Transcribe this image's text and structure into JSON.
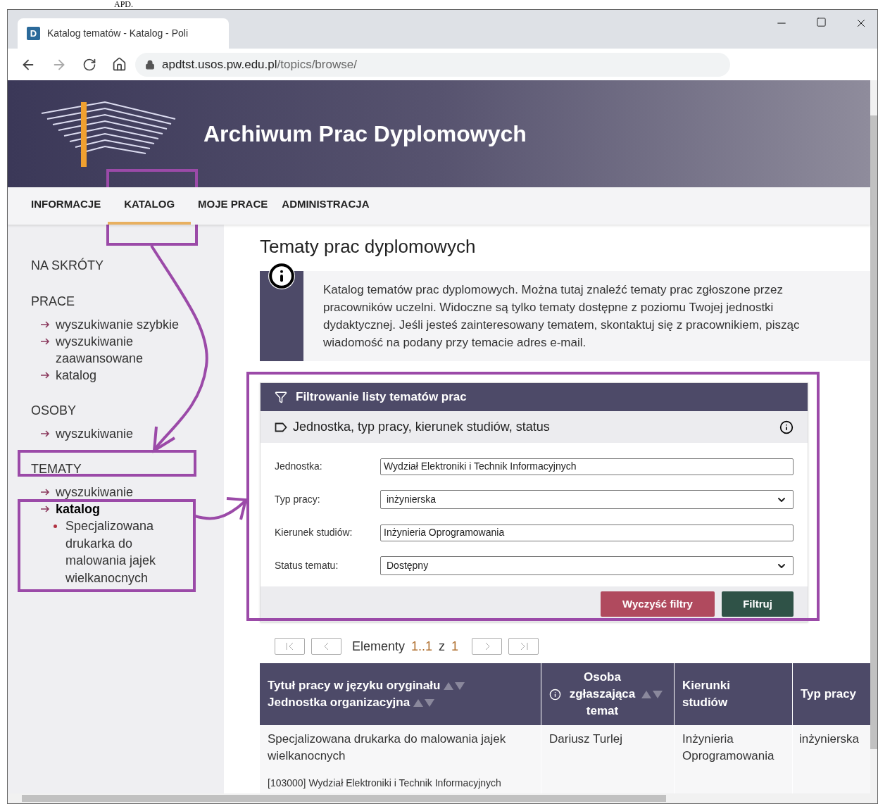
{
  "caption_fragment": "APD.",
  "browser": {
    "favicon": "D",
    "tab_title": "Katalog tematów - Katalog - Poli",
    "url_host": "apdtst.usos.pw.edu.pl",
    "url_path": "/topics/browse/"
  },
  "site": {
    "title": "Archiwum Prac Dyplomowych"
  },
  "nav": [
    {
      "label": "INFORMACJE",
      "selected": false
    },
    {
      "label": "KATALOG",
      "selected": true
    },
    {
      "label": "MOJE PRACE",
      "selected": false
    },
    {
      "label": "ADMINISTRACJA",
      "selected": false
    }
  ],
  "sidebar": [
    {
      "heading": "NA SKRÓTY"
    },
    {
      "heading": "PRACE",
      "items": [
        {
          "label": "wyszukiwanie szybkie",
          "selected": false
        },
        {
          "label": "wyszukiwanie zaawansowane",
          "selected": false
        },
        {
          "label": "katalog",
          "selected": false
        }
      ]
    },
    {
      "heading": "OSOBY",
      "items": [
        {
          "label": "wyszukiwanie",
          "selected": false
        }
      ]
    },
    {
      "heading": "TEMATY",
      "items": [
        {
          "label": "wyszukiwanie",
          "selected": false
        },
        {
          "label": "katalog",
          "selected": true,
          "children": [
            {
              "label": "Specjalizowana drukarka do malowania jajek wielkanocnych"
            }
          ]
        }
      ]
    }
  ],
  "page_title": "Tematy prac dyplomowych",
  "info_text": "Katalog tematów prac dyplomowych. Można tutaj znaleźć tematy prac zgłoszone przez pracowników uczelni. Widoczne są tylko tematy dostępne z poziomu Twojej jednostki dydaktycznej. Jeśli jesteś zainteresowany tematem, skontaktuj się z pracownikiem, pisząc wiadomość na podany przy temacie adres e-mail.",
  "filter": {
    "title": "Filtrowanie listy tematów prac",
    "section": "Jednostka, typ pracy, kierunek studiów, status",
    "fields": [
      {
        "label": "Jednostka:",
        "value": "Wydział Elektroniki i Technik Informacyjnych",
        "kind": "text"
      },
      {
        "label": "Typ pracy:",
        "value": "inżynierska",
        "kind": "select"
      },
      {
        "label": "Kierunek studiów:",
        "value": "Inżynieria Oprogramowania",
        "kind": "text"
      },
      {
        "label": "Status tematu:",
        "value": "Dostępny",
        "kind": "select"
      }
    ],
    "buttons": [
      {
        "label": "Wyczyść filtry",
        "kind": "clear"
      },
      {
        "label": "Filtruj",
        "kind": "submit"
      }
    ]
  },
  "pager": {
    "label": "Elementy",
    "range": "1..1",
    "of": "z",
    "total": "1"
  },
  "table": {
    "columns": [
      {
        "lines": [
          "Tytuł pracy w języku oryginału",
          "Jednostka organizacyjna"
        ],
        "sortable": true,
        "info": false
      },
      {
        "lines": [
          "Osoba zgłaszająca temat"
        ],
        "sortable": true,
        "info": true
      },
      {
        "lines": [
          "Kierunki studiów"
        ],
        "sortable": false,
        "info": false
      },
      {
        "lines": [
          "Typ pracy"
        ],
        "sortable": false,
        "info": false
      }
    ],
    "rows": [
      {
        "title": "Specjalizowana drukarka do malowania jajek wielkanocnych",
        "unit": "[103000] Wydział Elektroniki i Technik Informacyjnych",
        "person": "Dariusz Turlej",
        "field": "Inżynieria Oprogramowania",
        "type": "inżynierska"
      }
    ]
  }
}
